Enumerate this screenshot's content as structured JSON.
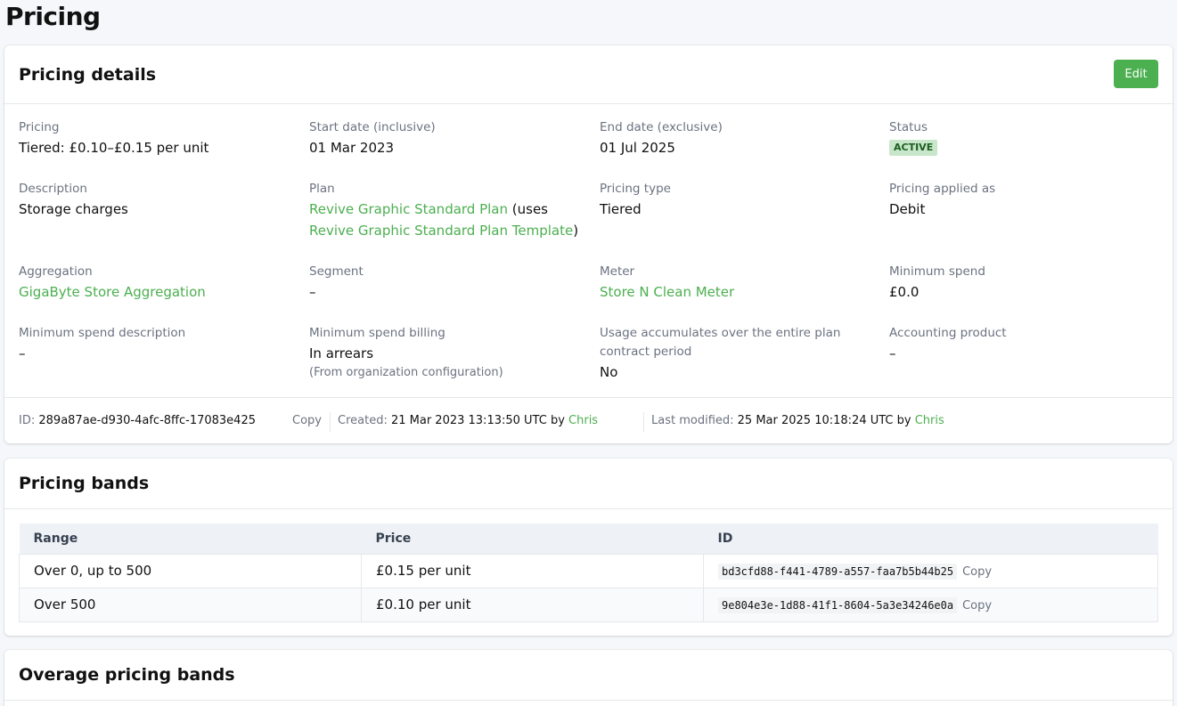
{
  "page_title": "Pricing",
  "details": {
    "title": "Pricing details",
    "edit_label": "Edit",
    "pricing_label": "Pricing",
    "pricing_value": "Tiered: £0.10–£0.15 per unit",
    "start_label": "Start date (inclusive)",
    "start_value": "01 Mar 2023",
    "end_label": "End date (exclusive)",
    "end_value": "01 Jul 2025",
    "status_label": "Status",
    "status_value": "ACTIVE",
    "description_label": "Description",
    "description_value": "Storage charges",
    "plan_label": "Plan",
    "plan_link": "Revive Graphic Standard Plan",
    "plan_uses": " (uses",
    "plan_template_link": "Revive Graphic Standard Plan Template",
    "plan_close": ")",
    "pricing_type_label": "Pricing type",
    "pricing_type_value": "Tiered",
    "applied_as_label": "Pricing applied as",
    "applied_as_value": "Debit",
    "aggregation_label": "Aggregation",
    "aggregation_link": "GigaByte Store Aggregation",
    "segment_label": "Segment",
    "segment_value": "–",
    "meter_label": "Meter",
    "meter_link": "Store N Clean Meter",
    "min_spend_label": "Minimum spend",
    "min_spend_value": "£0.0",
    "min_spend_desc_label": "Minimum spend description",
    "min_spend_desc_value": "–",
    "min_spend_billing_label": "Minimum spend billing",
    "min_spend_billing_value": "In arrears",
    "min_spend_billing_note": "(From organization configuration)",
    "usage_label_line1": "Usage accumulates over the entire plan",
    "usage_label_line2": "contract period",
    "usage_value": "No",
    "accounting_label": "Accounting product",
    "accounting_value": "–"
  },
  "meta": {
    "id_label": "ID:",
    "id_value": "289a87ae-d930-4afc-8ffc-17083e425",
    "copy_label": "Copy",
    "created_label": "Created:",
    "created_value": "21 Mar 2023 13:13:50 UTC by",
    "created_by": "Chris",
    "modified_label": "Last modified:",
    "modified_value": "25 Mar 2025 10:18:24 UTC by",
    "modified_by": "Chris"
  },
  "bands": {
    "title": "Pricing bands",
    "columns": [
      "Range",
      "Price",
      "ID"
    ],
    "rows": [
      {
        "range": "Over 0, up to 500",
        "price": "£0.15 per unit",
        "id": "bd3cfd88-f441-4789-a557-faa7b5b44b25",
        "copy": "Copy"
      },
      {
        "range": "Over 500",
        "price": "£0.10 per unit",
        "id": "9e804e3e-1d88-41f1-8604-5a3e34246e0a",
        "copy": "Copy"
      }
    ]
  },
  "overage": {
    "title": "Overage pricing bands"
  },
  "colors": {
    "accent": "#4caf50",
    "badge_bg": "#c8e6c9",
    "badge_text": "#1b5e20"
  }
}
